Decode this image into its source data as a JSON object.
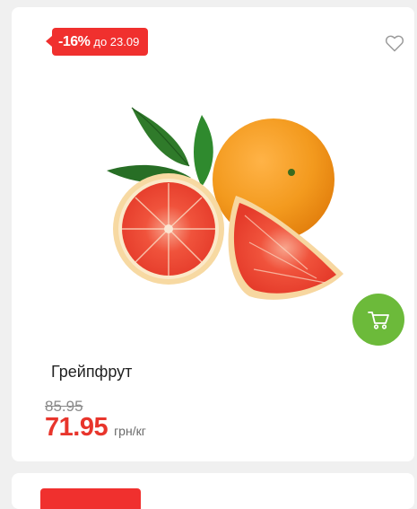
{
  "product": {
    "discount_percent": "-16%",
    "discount_until": "до 23.09",
    "name": "Грейпфрут",
    "old_price": "85.95",
    "price": "71.95",
    "unit": "грн/кг"
  },
  "colors": {
    "discount_badge": "#f0302e",
    "price": "#e8352c",
    "cart_button": "#6cba3a",
    "card_background": "#ffffff",
    "page_background": "#f0f0f0"
  },
  "icons": {
    "favorite": "heart-outline-icon",
    "cart": "shopping-cart-icon"
  }
}
